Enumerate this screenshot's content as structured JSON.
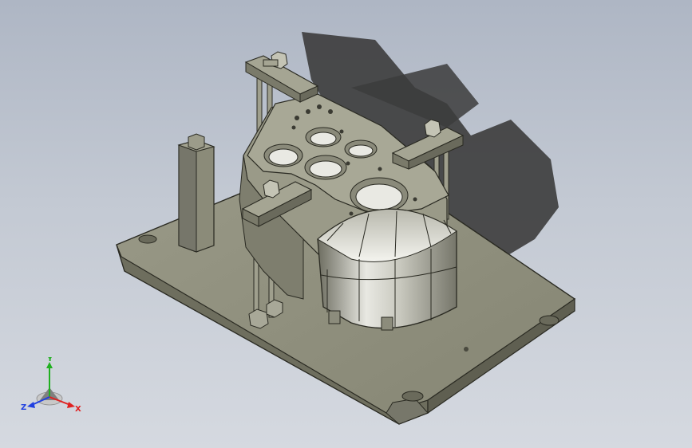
{
  "viewport": {
    "background_top": "#aeb6c4",
    "background_bottom": "#d5d9e0",
    "model_color": "#8f8f7c",
    "shadow_color": "#3a3a3a"
  },
  "triad": {
    "x_label": "X",
    "y_label": "Y",
    "z_label": "Z",
    "x_color": "#e02020",
    "y_color": "#20b020",
    "z_color": "#2040e0"
  }
}
